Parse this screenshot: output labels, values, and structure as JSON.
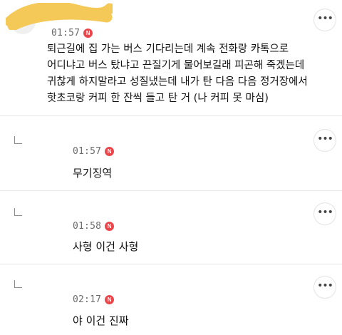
{
  "post": {
    "time": "01:57",
    "badge": "N",
    "more_label": "•••",
    "lines": [
      "퇴근길에 집 가는 버스 기다리는데 계속 전화랑 카톡으로",
      "어디냐고 버스 탔냐고 끈질기게 물어보길래 피곤해 죽겠는데",
      "귀찮게 하지말라고 성질냈는데 내가 탄 다음 다음 정거장에서",
      "핫초코랑 커피 한 잔씩 들고 탄 거 (나 커피 못 마심)"
    ]
  },
  "replies": [
    {
      "time": "01:57",
      "badge": "N",
      "text": "무기징역",
      "more_label": "•••"
    },
    {
      "time": "01:58",
      "badge": "N",
      "text": "사형 이건 사형",
      "more_label": "•••"
    },
    {
      "time": "02:17",
      "badge": "N",
      "text": "야 이건 진짜",
      "more_label": "•••"
    }
  ],
  "colors": {
    "scribble": "#f4c64e",
    "badge": "#e8484c",
    "divider": "#e6e6e6"
  },
  "icons": {
    "more": "ellipsis-icon",
    "reply": "reply-arrow-icon",
    "new": "new-badge-icon"
  }
}
